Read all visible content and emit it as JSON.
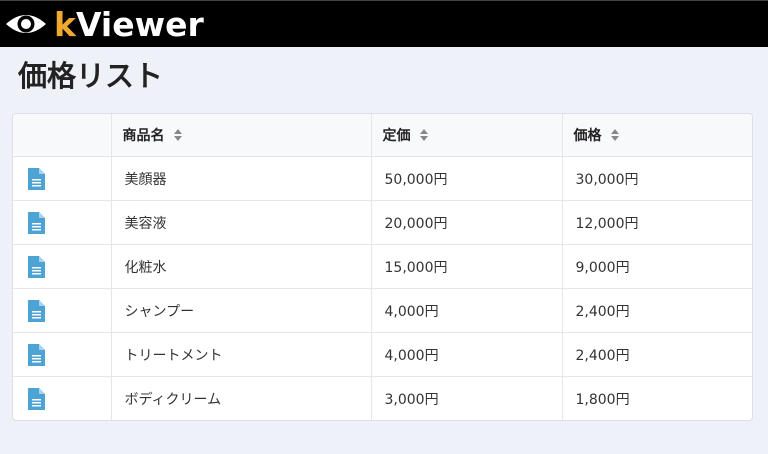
{
  "app": {
    "logo_k": "k",
    "logo_rest": "Viewer",
    "accent_color": "#f0a830"
  },
  "page": {
    "title": "価格リスト"
  },
  "table": {
    "headers": {
      "name": "商品名",
      "list_price": "定価",
      "price": "価格"
    },
    "row_icon": "document-icon",
    "rows": [
      {
        "name": "美顔器",
        "list_price": "50,000円",
        "price": "30,000円"
      },
      {
        "name": "美容液",
        "list_price": "20,000円",
        "price": "12,000円"
      },
      {
        "name": "化粧水",
        "list_price": "15,000円",
        "price": "9,000円"
      },
      {
        "name": "シャンプー",
        "list_price": "4,000円",
        "price": "2,400円"
      },
      {
        "name": "トリートメント",
        "list_price": "4,000円",
        "price": "2,400円"
      },
      {
        "name": "ボディクリーム",
        "list_price": "3,000円",
        "price": "1,800円"
      }
    ]
  }
}
